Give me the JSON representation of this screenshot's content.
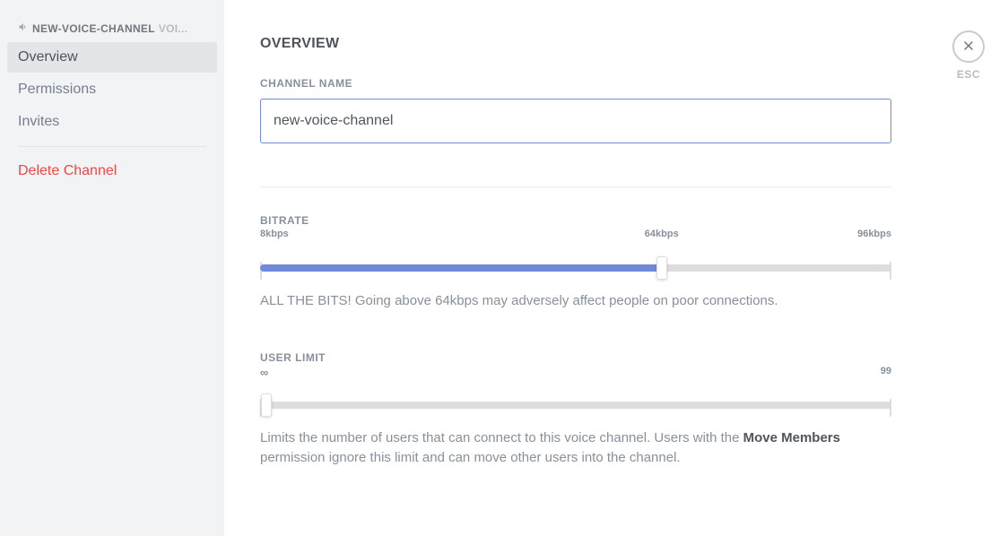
{
  "sidebar": {
    "channel_name": "NEW-VOICE-CHANNEL",
    "channel_category": "VOI...",
    "items": [
      {
        "label": "Overview"
      },
      {
        "label": "Permissions"
      },
      {
        "label": "Invites"
      }
    ],
    "delete_label": "Delete Channel"
  },
  "page": {
    "title": "OVERVIEW",
    "close_label": "ESC"
  },
  "channel_name_field": {
    "label": "CHANNEL NAME",
    "value": "new-voice-channel"
  },
  "bitrate": {
    "label": "BITRATE",
    "min": 8,
    "mid": 64,
    "max": 96,
    "value": 64,
    "min_label": "8kbps",
    "mid_label": "64kbps",
    "max_label": "96kbps",
    "help": "ALL THE BITS! Going above 64kbps may adversely affect people on poor connections."
  },
  "user_limit": {
    "label": "USER LIMIT",
    "min": 0,
    "max": 99,
    "value": 0,
    "min_label": "∞",
    "max_label": "99",
    "help_prefix": "Limits the number of users that can connect to this voice channel. Users with the ",
    "help_bold": "Move Members",
    "help_suffix": " permission ignore this limit and can move other users into the channel."
  }
}
